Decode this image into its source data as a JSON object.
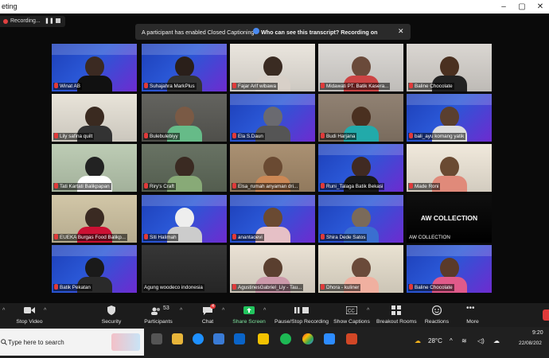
{
  "window": {
    "title": "eting"
  },
  "recording": {
    "label": "Recording..."
  },
  "cc_banner": {
    "message": "A participant has enabled Closed Captioning",
    "question": "Who can see this transcript? Recording on"
  },
  "participants": [
    {
      "name": "Winat AB"
    },
    {
      "name": "Suhajahra MarkPlus"
    },
    {
      "name": "Fajar Arif wibawa"
    },
    {
      "name": "Midawati PT. Batik Kasera..."
    },
    {
      "name": "Baline Chocolate"
    },
    {
      "name": "Lily safina quilt"
    },
    {
      "name": "Bulebulebiyy"
    },
    {
      "name": "Ela S.Daun"
    },
    {
      "name": "Budi Harjana"
    },
    {
      "name": "bali_ayu komang yatik"
    },
    {
      "name": "Tati Kartati Balikpapan"
    },
    {
      "name": "Riry's Craft"
    },
    {
      "name": "Elsa_rumah anyaman dri..."
    },
    {
      "name": "Runi_Talaga Batik Bekasi"
    },
    {
      "name": "Made Roni"
    },
    {
      "name": "EUEKA Burgas Food Balikp..."
    },
    {
      "name": "Siti Halimah"
    },
    {
      "name": "anantaoevi"
    },
    {
      "name": "Shira Dede Satos"
    },
    {
      "name": "AW COLLECTION",
      "tile_text": "AW COLLECTION"
    },
    {
      "name": "Batik Pekatan"
    },
    {
      "name": "Agung woodeco indonesia"
    },
    {
      "name": "AgustinesGabriel_Liy - Tau..."
    },
    {
      "name": "Dhora - kuliner"
    },
    {
      "name": "Baline Chocolate"
    }
  ],
  "toolbar": {
    "stop_video": "Stop Video",
    "security": "Security",
    "participants": "Participants",
    "participants_count": "53",
    "chat": "Chat",
    "chat_badge": "4",
    "share_screen": "Share Screen",
    "record": "Pause/Stop Recording",
    "captions": "Show Captions",
    "breakout": "Breakout Rooms",
    "reactions": "Reactions",
    "more": "More"
  },
  "taskbar": {
    "search_placeholder": "Type here to search",
    "temperature": "28°C",
    "time": "9:20",
    "date": "22/08/202"
  },
  "colors": {
    "speaker_outline": "#e4e426",
    "share_green": "#22c55e",
    "muted_red": "#e03a3a"
  }
}
